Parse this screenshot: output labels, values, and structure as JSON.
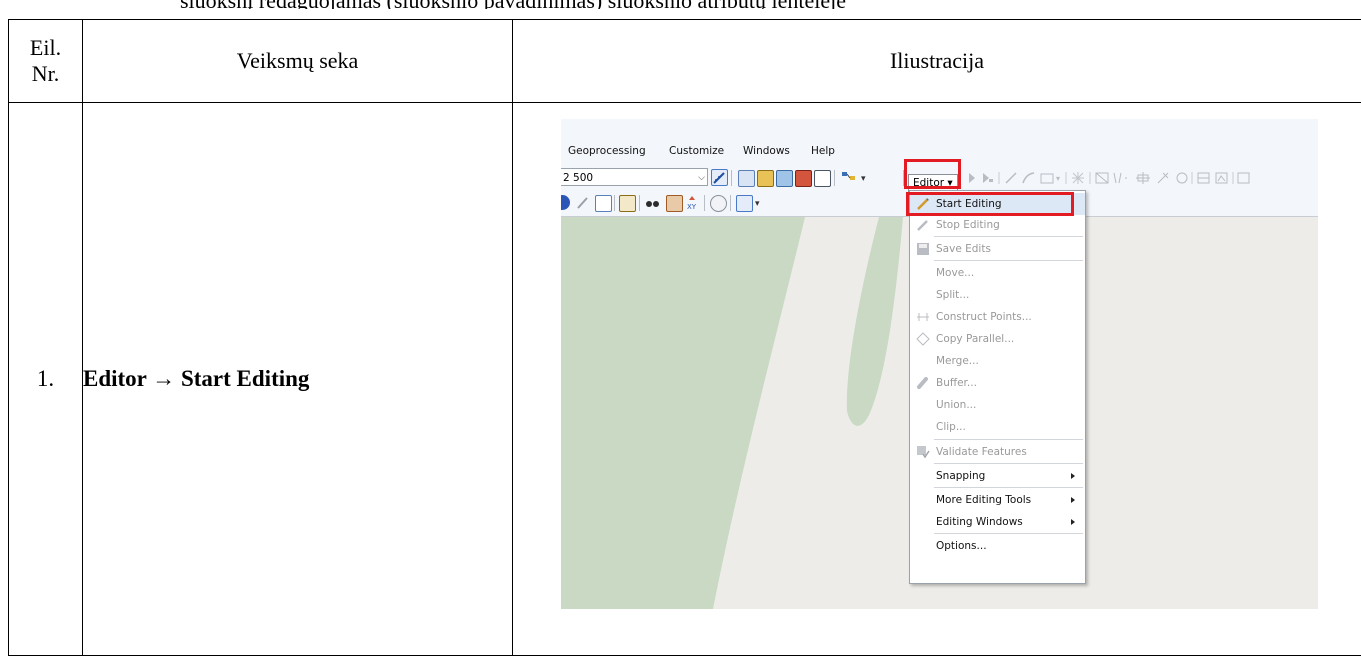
{
  "top_fragment": "sluoksnį redaguojamas (sluoksnio pavadinimas) sluoksnio atributų lentelėje",
  "table": {
    "headers": {
      "number": "Eil. Nr.",
      "number_line1": "Eil.",
      "number_line2": "Nr.",
      "steps": "Veiksmų seka",
      "illustration": "Iliustracija"
    },
    "rows": [
      {
        "number": "1.",
        "steps": "Editor → Start Editing"
      }
    ]
  },
  "screenshot": {
    "menubar": [
      "Geoprocessing",
      "Customize",
      "Windows",
      "Help"
    ],
    "scale_value": "2 500",
    "editor_label": "Editor ▾",
    "menu_items": [
      {
        "label": "Start Editing",
        "enabled": true,
        "icon": "pencil-icon"
      },
      {
        "label": "Stop Editing",
        "enabled": false,
        "icon": "pencil-icon"
      },
      {
        "label": "Save Edits",
        "enabled": false,
        "icon": "save-icon"
      },
      {
        "label": "Move...",
        "enabled": false
      },
      {
        "label": "Split...",
        "enabled": false
      },
      {
        "label": "Construct Points...",
        "enabled": false,
        "icon": "construct-points-icon"
      },
      {
        "label": "Copy Parallel...",
        "enabled": false,
        "icon": "copy-parallel-icon"
      },
      {
        "label": "Merge...",
        "enabled": false
      },
      {
        "label": "Buffer...",
        "enabled": false,
        "icon": "buffer-icon"
      },
      {
        "label": "Union...",
        "enabled": false
      },
      {
        "label": "Clip...",
        "enabled": false
      },
      {
        "label": "Validate Features",
        "enabled": false,
        "icon": "validate-icon"
      },
      {
        "label": "Snapping",
        "enabled": true,
        "submenu": true
      },
      {
        "label": "More Editing Tools",
        "enabled": true,
        "submenu": true
      },
      {
        "label": "Editing Windows",
        "enabled": true,
        "submenu": true
      },
      {
        "label": "Options...",
        "enabled": true
      }
    ],
    "colors": {
      "highlight": "#e31b23",
      "map_bg": "#edece8",
      "green_area": "#c9d9c4"
    }
  }
}
